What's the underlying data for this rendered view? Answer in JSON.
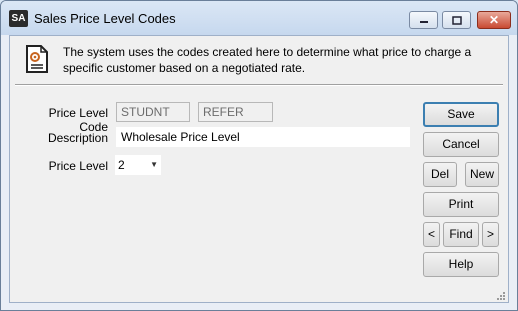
{
  "window": {
    "app_icon": "SA",
    "title": "Sales Price Level Codes"
  },
  "info": {
    "icon": "document-gear-icon",
    "text": "The system uses the codes created here to determine what price to charge a specific customer based on a negotiated rate."
  },
  "form": {
    "price_level_code_label": "Price Level Code",
    "code1_value": "STUDNT",
    "code2_value": "REFER",
    "description_label": "Description",
    "description_value": "Wholesale Price Level",
    "price_level_label": "Price Level",
    "price_level_value": "2"
  },
  "buttons": {
    "save": "Save",
    "cancel": "Cancel",
    "del": "Del",
    "new": "New",
    "print": "Print",
    "prev": "<",
    "find": "Find",
    "next": ">",
    "help": "Help"
  }
}
